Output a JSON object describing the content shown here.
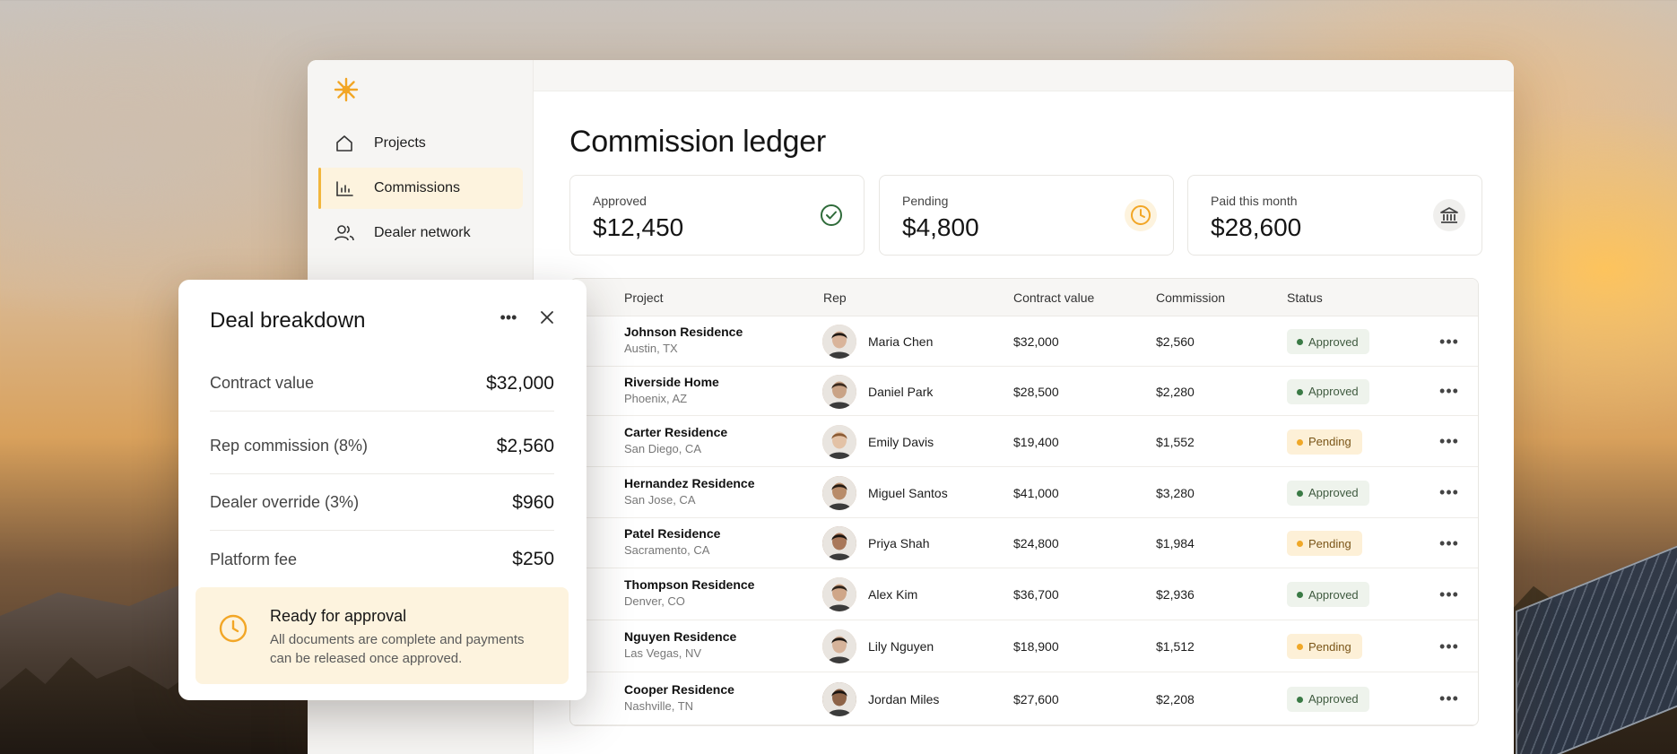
{
  "app": {
    "brand_color": "#f2a626",
    "logo_icon": "sun-icon"
  },
  "sidebar": {
    "items": [
      {
        "label": "Projects",
        "icon": "home-icon",
        "active": false
      },
      {
        "label": "Commissions",
        "icon": "bar-chart-icon",
        "active": true
      },
      {
        "label": "Dealer network",
        "icon": "users-icon",
        "active": false
      }
    ]
  },
  "main": {
    "title": "Commission ledger",
    "stats": [
      {
        "label": "Approved",
        "value": "$12,450",
        "icon": "check-circle-icon",
        "color": "#2f6b3a"
      },
      {
        "label": "Pending",
        "value": "$4,800",
        "icon": "clock-icon",
        "color": "#f2a626"
      },
      {
        "label": "Paid this month",
        "value": "$28,600",
        "icon": "bank-icon",
        "color": "#444444"
      }
    ],
    "table": {
      "columns": [
        "Project",
        "Rep",
        "Contract value",
        "Commission",
        "Status"
      ],
      "rows": [
        {
          "project": "Johnson Residence",
          "location": "Austin, TX",
          "rep": "Maria Chen",
          "contract": "$32,000",
          "commission": "$2,560",
          "status": "Approved"
        },
        {
          "project": "Riverside Home",
          "location": "Phoenix, AZ",
          "rep": "Daniel Park",
          "contract": "$28,500",
          "commission": "$2,280",
          "status": "Approved"
        },
        {
          "project": "Carter Residence",
          "location": "San Diego, CA",
          "rep": "Emily Davis",
          "contract": "$19,400",
          "commission": "$1,552",
          "status": "Pending"
        },
        {
          "project": "Hernandez Residence",
          "location": "San Jose, CA",
          "rep": "Miguel Santos",
          "contract": "$41,000",
          "commission": "$3,280",
          "status": "Approved"
        },
        {
          "project": "Patel Residence",
          "location": "Sacramento, CA",
          "rep": "Priya Shah",
          "contract": "$24,800",
          "commission": "$1,984",
          "status": "Pending"
        },
        {
          "project": "Thompson Residence",
          "location": "Denver, CO",
          "rep": "Alex Kim",
          "contract": "$36,700",
          "commission": "$2,936",
          "status": "Approved"
        },
        {
          "project": "Nguyen Residence",
          "location": "Las Vegas, NV",
          "rep": "Lily Nguyen",
          "contract": "$18,900",
          "commission": "$1,512",
          "status": "Pending"
        },
        {
          "project": "Cooper Residence",
          "location": "Nashville, TN",
          "rep": "Jordan Miles",
          "contract": "$27,600",
          "commission": "$2,208",
          "status": "Approved"
        }
      ]
    }
  },
  "drawer": {
    "title": "Deal breakdown",
    "items": [
      {
        "label": "Contract value",
        "value": "$32,000"
      },
      {
        "label": "Rep commission (8%)",
        "value": "$2,560"
      },
      {
        "label": "Dealer override (3%)",
        "value": "$960"
      },
      {
        "label": "Platform fee",
        "value": "$250"
      }
    ],
    "callout": {
      "title": "Ready for approval",
      "text": "All documents are complete and payments can be released once approved.",
      "icon": "clock-icon"
    }
  }
}
